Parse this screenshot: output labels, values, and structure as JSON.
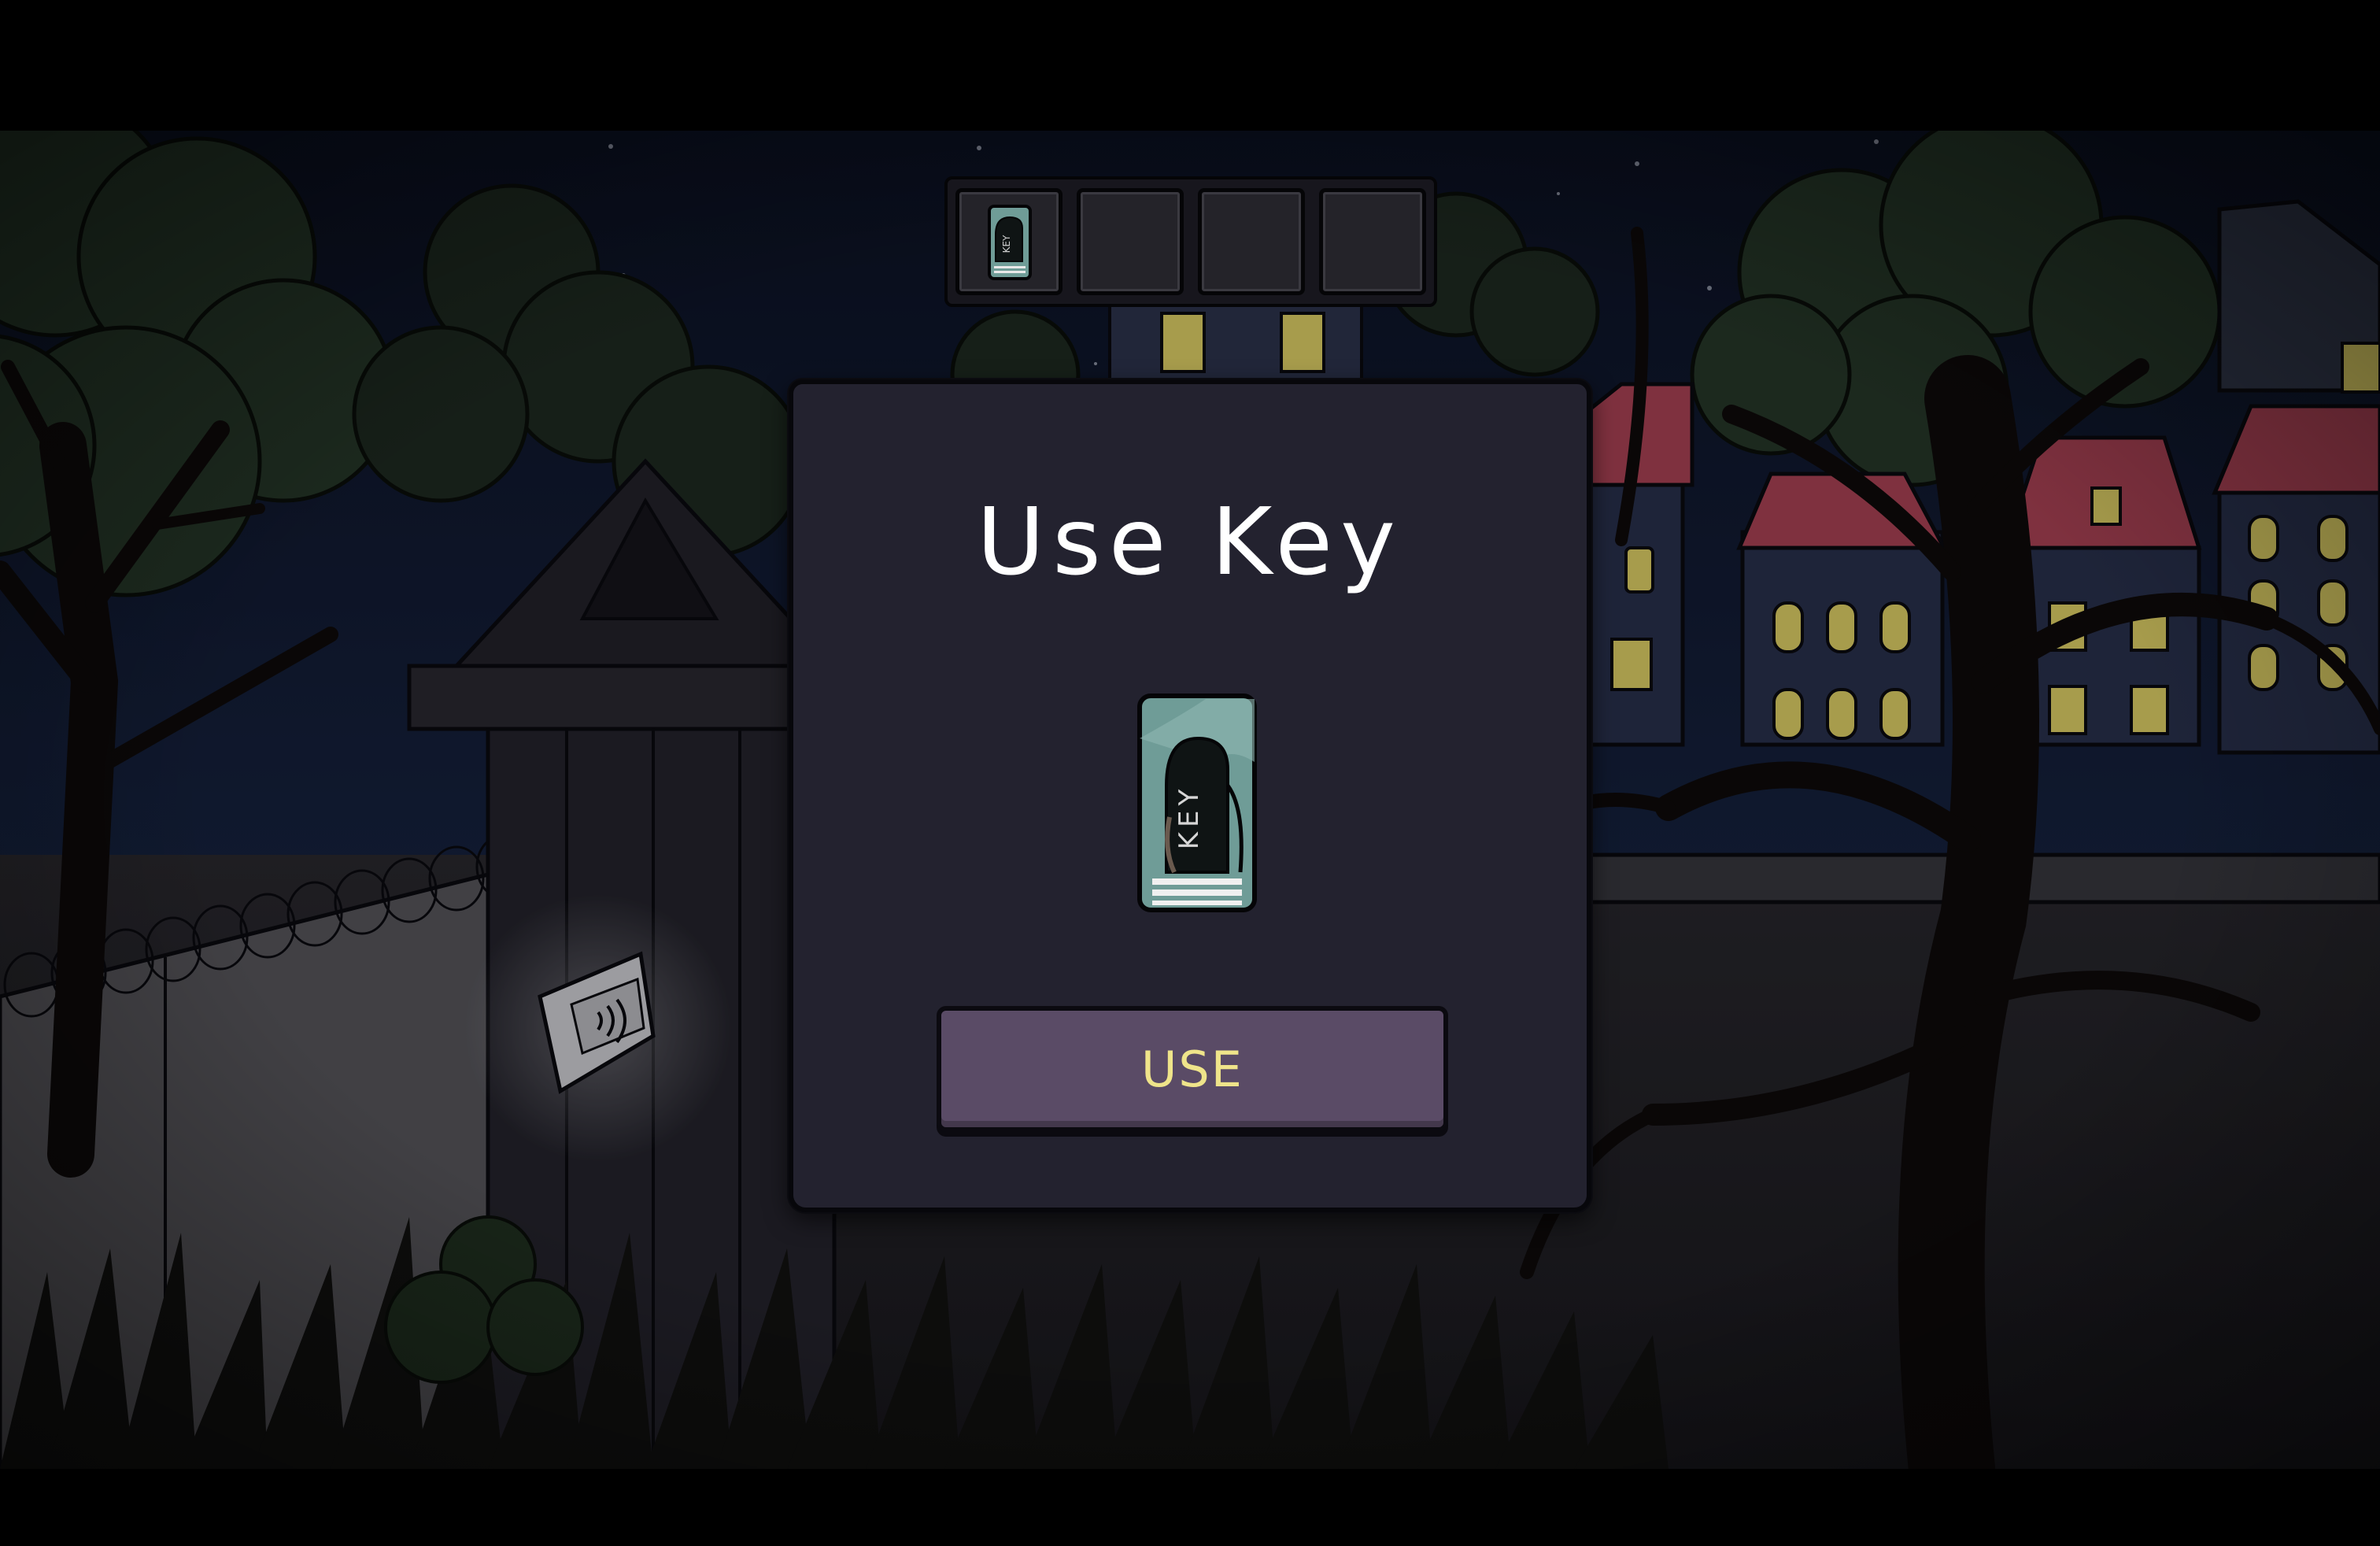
{
  "inventory": {
    "slots": [
      {
        "item": "key-card",
        "label": "KEY"
      },
      {
        "item": ""
      },
      {
        "item": ""
      },
      {
        "item": ""
      }
    ]
  },
  "dialog": {
    "title": "Use Key",
    "item_label": "KEY",
    "button_label": "USE"
  },
  "colors": {
    "dialog_bg": "#23222f",
    "button_bg": "#5a4b66",
    "button_text": "#efe48a",
    "key_teal": "#6f9c97",
    "window_light": "#e8d86a",
    "roof_red": "#b04458"
  }
}
